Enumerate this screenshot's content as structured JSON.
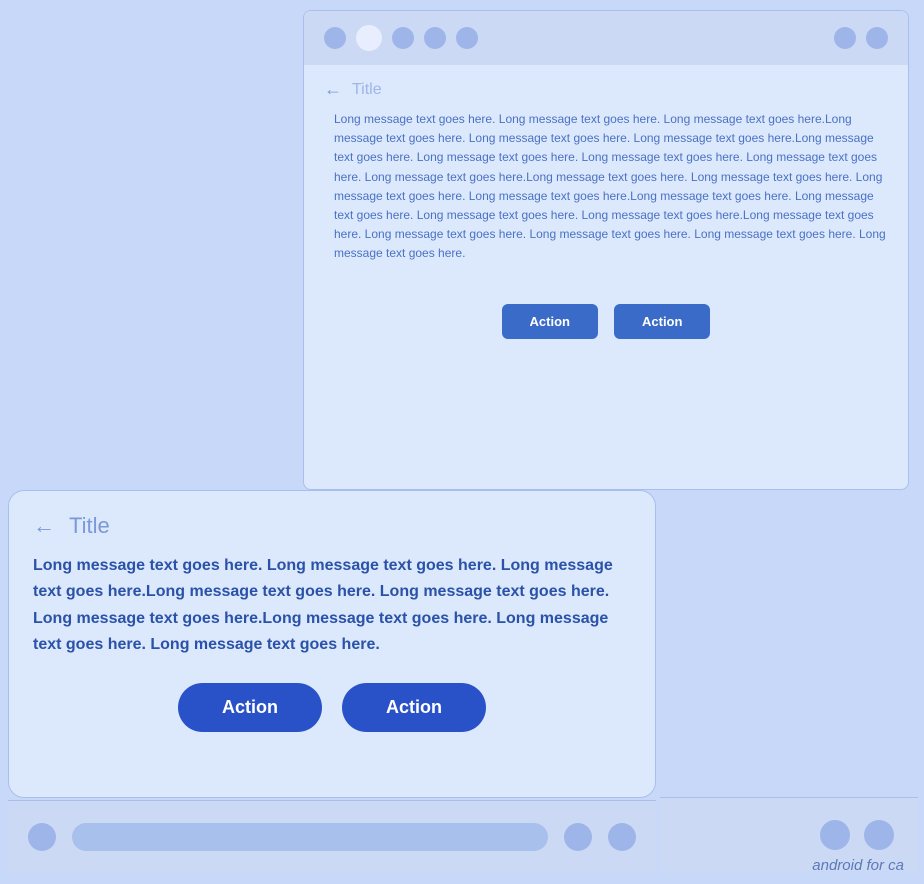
{
  "top_card": {
    "title": "Title",
    "message": "Long message text goes here. Long message text goes here. Long message text goes here.Long message text goes here. Long message text goes here. Long message text goes here.Long message text goes here. Long message text goes here. Long message text goes here. Long message text goes here. Long message text goes here.Long message text goes here. Long message text goes here. Long message text goes here. Long message text goes here.Long message text goes here. Long message text goes here. Long message text goes here. Long message text goes here.Long message text goes here. Long message text goes here. Long message text goes here. Long message text goes here. Long message text goes here.",
    "action1_label": "Action",
    "action2_label": "Action"
  },
  "bottom_card": {
    "title": "Title",
    "message": "Long message text goes here. Long message text goes here. Long message text goes here.Long message text goes here. Long message text goes here. Long message text goes here.Long message text goes here. Long message text goes here. Long message text goes here.",
    "action1_label": "Action",
    "action2_label": "Action"
  },
  "watermark": "android for ca"
}
